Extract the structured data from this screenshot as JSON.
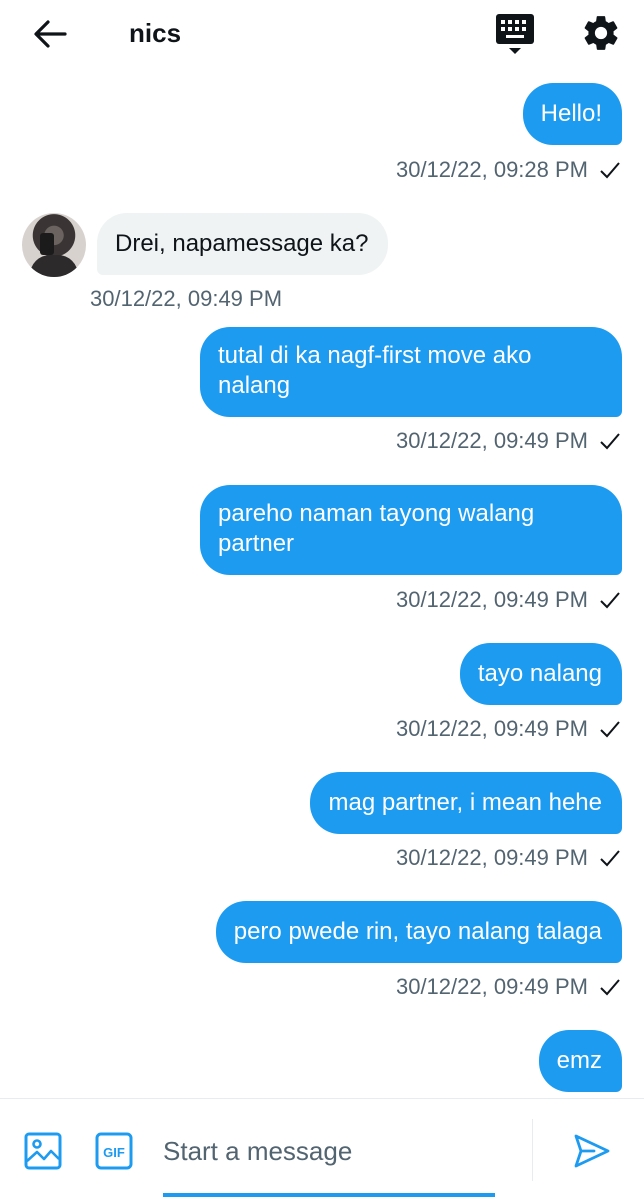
{
  "header": {
    "title": "nics",
    "back_icon": "arrow-left-icon",
    "keyboard_icon": "keyboard-icon",
    "settings_icon": "gear-icon"
  },
  "messages": [
    {
      "direction": "out",
      "text": "Hello!",
      "timestamp": "30/12/22, 09:28 PM",
      "seen": true
    },
    {
      "direction": "in",
      "text": "Drei, napamessage ka?",
      "timestamp": "30/12/22, 09:49 PM"
    },
    {
      "direction": "out",
      "text": "tutal di ka nagf-first move ako nalang",
      "timestamp": "30/12/22, 09:49 PM",
      "seen": true
    },
    {
      "direction": "out",
      "text": "pareho naman tayong walang partner",
      "timestamp": "30/12/22, 09:49 PM",
      "seen": true
    },
    {
      "direction": "out",
      "text": "tayo nalang",
      "timestamp": "30/12/22, 09:49 PM",
      "seen": true
    },
    {
      "direction": "out",
      "text": "mag partner, i mean hehe",
      "timestamp": "30/12/22, 09:49 PM",
      "seen": true
    },
    {
      "direction": "out",
      "text": "pero pwede rin, tayo nalang talaga",
      "timestamp": "30/12/22, 09:49 PM",
      "seen": true
    },
    {
      "direction": "out",
      "text": "emz"
    }
  ],
  "composer": {
    "placeholder": "Start a message",
    "value": "",
    "gif_label": "GIF"
  },
  "colors": {
    "accent": "#1d9bf0",
    "incoming_bubble": "#eff3f4",
    "muted_text": "#536471"
  }
}
